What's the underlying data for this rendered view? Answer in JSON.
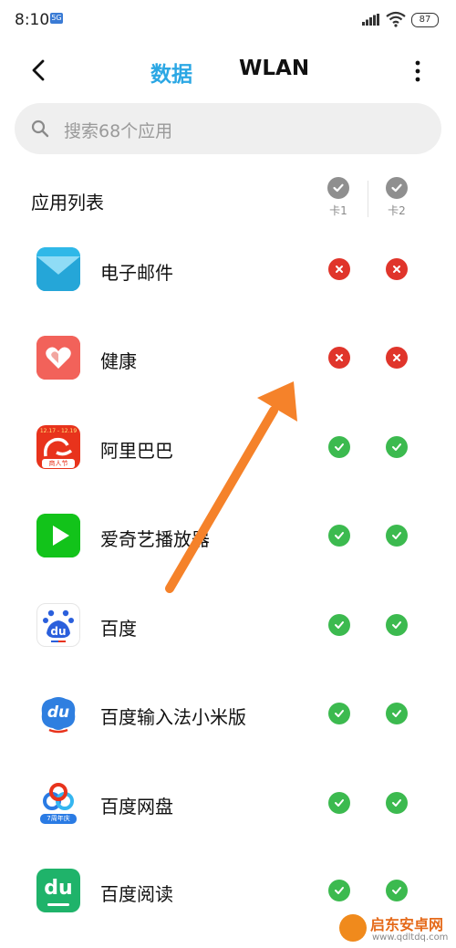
{
  "status_bar": {
    "time": "8:10",
    "notif_badge": "5G",
    "battery": "87"
  },
  "header": {
    "tab_data": "数据",
    "tab_wlan": "WLAN",
    "back_icon": "chevron-left-icon",
    "more_icon": "more-vertical-icon"
  },
  "search": {
    "placeholder": "搜索68个应用"
  },
  "list": {
    "title": "应用列表",
    "col1_label": "卡1",
    "col2_label": "卡2",
    "apps": [
      {
        "name": "电子邮件",
        "icon": "email-icon",
        "sim1": "blocked",
        "sim2": "blocked"
      },
      {
        "name": "健康",
        "icon": "health-icon",
        "sim1": "blocked",
        "sim2": "blocked"
      },
      {
        "name": "阿里巴巴",
        "icon": "alibaba-icon",
        "icon_text": "12.17 - 12.19",
        "icon_badge": "商人节",
        "sim1": "allowed",
        "sim2": "allowed"
      },
      {
        "name": "爱奇艺播放器",
        "icon": "iqiyi-play-icon",
        "sim1": "allowed",
        "sim2": "allowed"
      },
      {
        "name": "百度",
        "icon": "baidu-icon",
        "icon_text": "du",
        "sim1": "allowed",
        "sim2": "allowed"
      },
      {
        "name": "百度输入法小米版",
        "icon": "baidu-input-icon",
        "icon_text": "du",
        "sim1": "allowed",
        "sim2": "allowed"
      },
      {
        "name": "百度网盘",
        "icon": "baidu-netdisk-icon",
        "icon_badge": "7周年庆",
        "sim1": "allowed",
        "sim2": "allowed"
      },
      {
        "name": "百度阅读",
        "icon": "baidu-read-icon",
        "icon_text": "du",
        "sim1": "allowed",
        "sim2": "allowed"
      }
    ]
  },
  "colors": {
    "accent": "#2ba7e4",
    "allowed": "#3cba4f",
    "blocked": "#e0352b",
    "arrow": "#f5822a"
  },
  "watermark": {
    "title": "启东安卓网",
    "url": "www.qdltdq.com"
  }
}
